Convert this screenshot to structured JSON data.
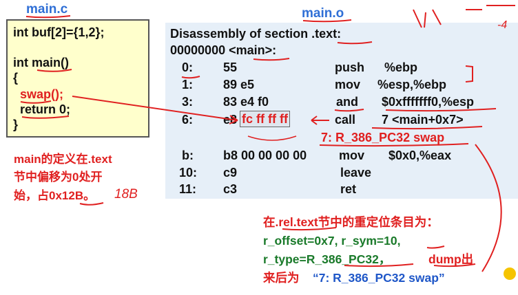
{
  "labels": {
    "source_file": "main.c",
    "object_file": "main.o"
  },
  "source": {
    "line1": "int buf[2]={1,2};",
    "line2": "int main()",
    "line3": "{",
    "line4": "  swap();",
    "line5": "  return 0;",
    "line6": "}"
  },
  "disasm": {
    "header1": "Disassembly of section .text:",
    "header2": "00000000 <main>:",
    "rows": [
      {
        "addr": "0:",
        "bytes": "55",
        "op": "push",
        "args": "%ebp"
      },
      {
        "addr": "1:",
        "bytes": "89 e5",
        "op": "mov",
        "args": "%esp,%ebp"
      },
      {
        "addr": "3:",
        "bytes": "83 e4 f0",
        "op": "and",
        "args": "$0xfffffff0,%esp"
      },
      {
        "addr": "6:",
        "bytes": "e8",
        "bytes_boxed": "fc ff ff ff",
        "op": "call",
        "args": "7 <main+0x7>"
      },
      {
        "addr": "b:",
        "bytes": "b8 00 00 00 00",
        "op": "mov",
        "args": "$0x0,%eax"
      },
      {
        "addr": "10:",
        "bytes": "c9",
        "op": "leave",
        "args": ""
      },
      {
        "addr": "11:",
        "bytes": "c3",
        "op": "ret",
        "args": ""
      }
    ],
    "reloc_line": "7: R_386_PC32 swap"
  },
  "notes": {
    "main_def_line1": "main的定义在.text",
    "main_def_line2": "节中偏移为0处开",
    "main_def_line3": "始，占0x12B。",
    "handwritten_18b": "18B",
    "handwritten_bottom": "-4"
  },
  "rel": {
    "line1": "在.rel.text节中的重定位条目为：",
    "line2": "r_offset=0x7, r_sym=10,",
    "line3_a": "r_type=R_386_PC32，",
    "line3_b": "dump出",
    "line4_a": "来后为",
    "line4_b": "“7: R_386_PC32 swap”"
  },
  "colors": {
    "blue": "#2f6fd6",
    "red": "#e02020",
    "green": "#1a7a2a",
    "panel": "#e6eff8",
    "code_bg": "#ffffcc"
  }
}
